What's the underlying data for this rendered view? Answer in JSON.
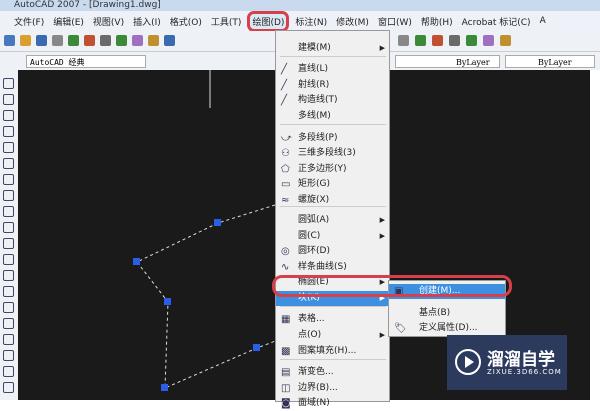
{
  "window": {
    "title": "AutoCAD 2007 - [Drawing1.dwg]"
  },
  "menubar": [
    "文件(F)",
    "编辑(E)",
    "视图(V)",
    "插入(I)",
    "格式(O)",
    "工具(T)",
    "绘图(D)",
    "标注(N)",
    "修改(M)",
    "窗口(W)",
    "帮助(H)",
    "Acrobat 标记(C)",
    "A"
  ],
  "toolbar": {
    "workspace": "AutoCAD 经典",
    "linetype": "ByLayer",
    "lineweight": "ByLayer"
  },
  "draw_menu": [
    {
      "label": "建模(M)",
      "icon": "",
      "submenu": true
    },
    {
      "label": "直线(L)",
      "icon": "line-icon"
    },
    {
      "label": "射线(R)",
      "icon": "ray-icon"
    },
    {
      "label": "构造线(T)",
      "icon": "xline-icon"
    },
    {
      "label": "多线(M)",
      "icon": ""
    },
    {
      "label": "多段线(P)",
      "icon": "polyline-icon"
    },
    {
      "label": "三维多段线(3)",
      "icon": "3dpoly-icon"
    },
    {
      "label": "正多边形(Y)",
      "icon": "polygon-icon"
    },
    {
      "label": "矩形(G)",
      "icon": "rectangle-icon"
    },
    {
      "label": "螺旋(X)",
      "icon": "helix-icon"
    },
    {
      "label": "圆弧(A)",
      "icon": "",
      "submenu": true
    },
    {
      "label": "圆(C)",
      "icon": "",
      "submenu": true
    },
    {
      "label": "圆环(D)",
      "icon": "donut-icon"
    },
    {
      "label": "样条曲线(S)",
      "icon": "spline-icon"
    },
    {
      "label": "椭圆(E)",
      "icon": "",
      "submenu": true
    },
    {
      "label": "块(K)",
      "icon": "",
      "submenu": true,
      "highlighted": true
    },
    {
      "label": "表格...",
      "icon": "table-icon"
    },
    {
      "label": "点(O)",
      "icon": "",
      "submenu": true
    },
    {
      "label": "图案填充(H)...",
      "icon": "hatch-icon"
    },
    {
      "label": "渐变色...",
      "icon": "gradient-icon"
    },
    {
      "label": "边界(B)...",
      "icon": "boundary-icon"
    },
    {
      "label": "面域(N)",
      "icon": "region-icon"
    }
  ],
  "block_submenu": [
    {
      "label": "创建(M)...",
      "highlighted": true
    },
    {
      "label": "基点(B)"
    },
    {
      "label": "定义属性(D)..."
    }
  ],
  "watermark": {
    "name": "溜溜自学",
    "url": "ZIXUE.3D66.COM"
  },
  "colors": {
    "highlight": "#3d8fe0",
    "annotation": "#d6404a",
    "canvas": "#1a1a1a"
  }
}
